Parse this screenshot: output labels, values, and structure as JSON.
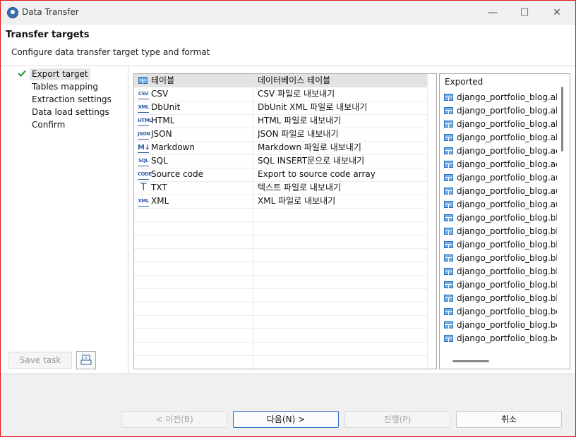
{
  "window": {
    "title": "Data Transfer",
    "controls": {
      "minimize": "—",
      "maximize": "☐",
      "close": "✕"
    }
  },
  "header": {
    "title": "Transfer targets",
    "subtitle": "Configure data transfer target type and format"
  },
  "nav": {
    "items": [
      {
        "label": "Export target",
        "selected": true,
        "checked": true
      },
      {
        "label": "Tables mapping"
      },
      {
        "label": "Extraction settings"
      },
      {
        "label": "Data load settings"
      },
      {
        "label": "Confirm"
      }
    ],
    "save_task_label": "Save task"
  },
  "grid": {
    "columns": [
      "테이블",
      "데이터베이스 테이블"
    ],
    "rows": [
      {
        "icon": "csv-icon",
        "icon_text": "CSV",
        "name": "CSV",
        "desc": "CSV 파일로 내보내기"
      },
      {
        "icon": "xml-icon",
        "icon_text": "XML",
        "name": "DbUnit",
        "desc": "DbUnit XML 파일로 내보내기"
      },
      {
        "icon": "html-icon",
        "icon_text": "HTML",
        "name": "HTML",
        "desc": "HTML 파일로 내보내기"
      },
      {
        "icon": "json-icon",
        "icon_text": "JSON",
        "name": "JSON",
        "desc": "JSON 파일로 내보내기"
      },
      {
        "icon": "markdown-icon",
        "icon_text": "M↓",
        "name": "Markdown",
        "desc": "Markdown 파일로 내보내기"
      },
      {
        "icon": "sql-icon",
        "icon_text": "SQL",
        "name": "SQL",
        "desc": "SQL INSERT문으로 내보내기"
      },
      {
        "icon": "code-icon",
        "icon_text": "CODE",
        "name": "Source code",
        "desc": "Export to source code array"
      },
      {
        "icon": "text-icon",
        "icon_text": "T",
        "name": "TXT",
        "desc": "텍스트 파일로 내보내기"
      },
      {
        "icon": "xml-icon",
        "icon_text": "XML",
        "name": "XML",
        "desc": "XML 파일로 내보내기"
      }
    ]
  },
  "exported": {
    "title": "Exported",
    "items": [
      "django_portfolio_blog.abou",
      "django_portfolio_blog.abst",
      "django_portfolio_blog.abst",
      "django_portfolio_blog.abst",
      "django_portfolio_blog.acco",
      "django_portfolio_blog.acco",
      "django_portfolio_blog.auth",
      "django_portfolio_blog.auth",
      "django_portfolio_blog.auth",
      "django_portfolio_blog.blog",
      "django_portfolio_blog.blog",
      "django_portfolio_blog.blog",
      "django_portfolio_blog.blog",
      "django_portfolio_blog.blog",
      "django_portfolio_blog.blog",
      "django_portfolio_blog.blog",
      "django_portfolio_blog.boo",
      "django_portfolio_blog.boo",
      "django_portfolio_blog.boo"
    ]
  },
  "footer": {
    "prev_label": "< 이전(B)",
    "next_label": "다음(N) >",
    "proceed_label": "진행(P)",
    "cancel_label": "취소"
  }
}
